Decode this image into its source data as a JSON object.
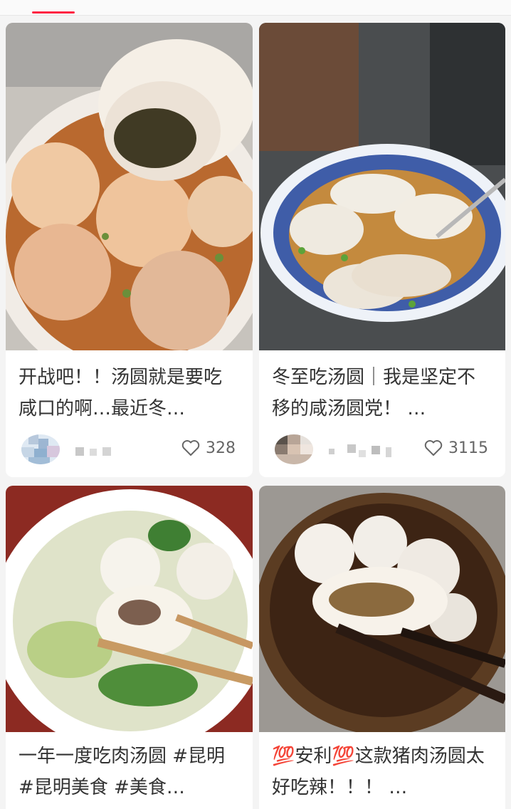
{
  "tabs": {
    "active_indicator_color": "#ff2442"
  },
  "feed": {
    "cards": [
      {
        "title": "开战吧！！汤圆就是要吃咸口的啊…最近冬…",
        "author": {
          "avatar_icon": "pixelated-avatar",
          "name_obscured": true
        },
        "likes": "328",
        "image": "savory-tangyuan-chili-oil-bowl"
      },
      {
        "title": "冬至吃汤圆｜我是坚定不移的咸汤圆党！ …",
        "author": {
          "avatar_icon": "pixelated-avatar",
          "name_obscured": true
        },
        "likes": "3115",
        "image": "tangyuan-in-blue-patterned-bowl"
      },
      {
        "title": "一年一度吃肉汤圆 #昆明 #昆明美食 #美食…",
        "image": "meat-tangyuan-cabbage-soup-chopsticks"
      },
      {
        "title": "💯安利💯这款猪肉汤圆太好吃辣！！！ …",
        "image": "pork-tangyuan-brown-soup-chopsticks"
      }
    ]
  },
  "icons": {
    "like": "heart-outline-icon"
  }
}
